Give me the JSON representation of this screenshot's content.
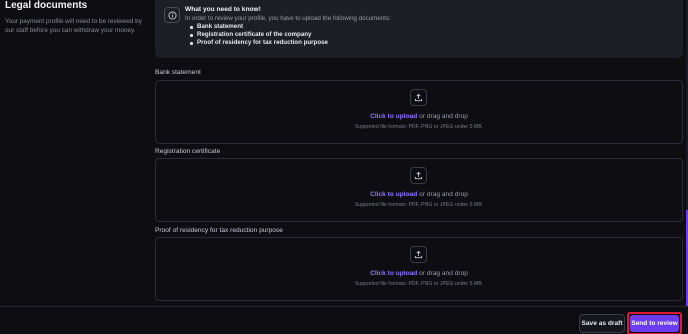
{
  "section": {
    "title": "Legal documents",
    "description": "Your payment profile will need to be reviewed by our staff before you can withdraw your money."
  },
  "info": {
    "icon": "info-icon",
    "title": "What you need to know!",
    "intro": "In order to review your profile, you have to upload the following documents:",
    "items": [
      "Bank statement",
      "Registration certificate of the company",
      "Proof of residency for tax reduction purpose"
    ]
  },
  "uploads": [
    {
      "label": "Bank statement",
      "link_text": "Click to upload",
      "rest_text": " or drag and drop",
      "formats": "Supported file formats: PDF, PNG or JPEG under 5 MB."
    },
    {
      "label": "Registration certificate",
      "link_text": "Click to upload",
      "rest_text": " or drag and drop",
      "formats": "Supported file formats: PDF, PNG or JPEG under 5 MB."
    },
    {
      "label": "Proof of residency for tax reduction purpose",
      "link_text": "Click to upload",
      "rest_text": " or drag and drop",
      "formats": "Supported file formats: PDF, PNG or JPEG under 5 MB."
    }
  ],
  "footer": {
    "save_draft_label": "Save as draft",
    "send_review_label": "Send to review"
  },
  "colors": {
    "accent": "#6c3cf0",
    "link": "#8f74ff",
    "highlight_outline": "#e0193a",
    "background": "#0d0d12",
    "info_box": "#1d1e26"
  }
}
